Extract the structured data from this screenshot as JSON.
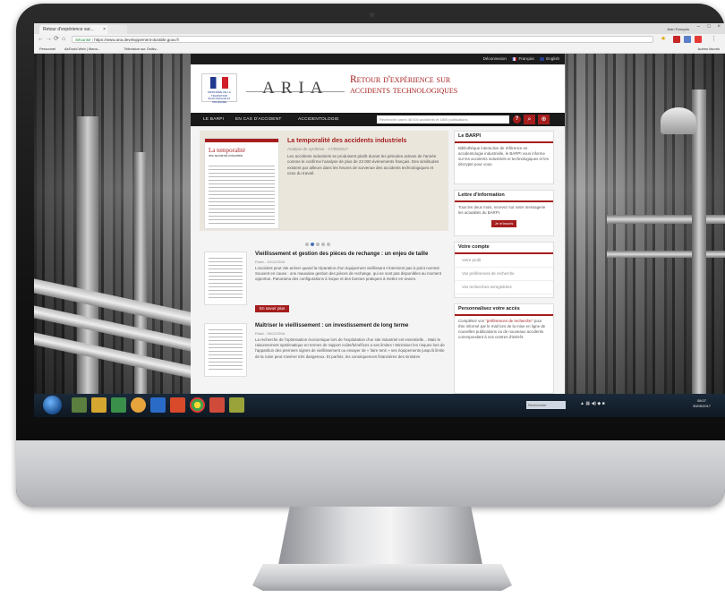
{
  "browser": {
    "tab_title": "Retour d'expérience sur...",
    "user_chip": "Jean François",
    "url_secure": "Sécurisé",
    "url": "https://www.aria.developpement-durable.gouv.fr",
    "bookmarks": [
      "Personnel",
      "AirDroid Web | Manu...",
      "Télévision sur Orditv..."
    ],
    "bookmarks_other": "Autres favoris"
  },
  "site": {
    "lang_bar": {
      "deconnexion": "Déconnexion",
      "francais": "Français",
      "english": "English"
    },
    "logo_text": "ARIA",
    "rf_text": "MINISTÈRE DE LA TRANSITION ÉCOLOGIQUE ET SOLIDAIRE",
    "title_line1": "Retour d'expérience sur",
    "title_line2": "accidents technologiques",
    "nav": {
      "items": [
        "LE BARPI",
        "EN CAS D'ACCIDENT",
        "ACCIDENTOLOGIE"
      ],
      "search_placeholder": "Recherche parmi 48 000 accidents et 1800 publications",
      "help": "?",
      "search_icon": "magnifier-icon",
      "advanced_icon": "advanced-search-icon"
    },
    "carousel": {
      "thumb_title": "La temporalité",
      "thumb_sub": "des accidents industriels",
      "title": "La temporalité des accidents industriels",
      "date": "Analyse de synthèse - 17/05/2017",
      "text": "Les accidents industriels se produisent plutôt durant les périodes actives de l'année comme le confirme l'analyse de plus de 23 000 événements français. Des similitudes existent par ailleurs dans les heures de survenue des accidents technologiques et ceux du travail."
    },
    "articles": [
      {
        "title": "Vieillissement et gestion des pièces de rechange : un enjeu de taille",
        "date": "Flash - 10/12/2016",
        "text": "L'accident peut vite arriver quand la réparation d'un équipement vieillissant n'intervient pas à point nommé. Souvent en cause : une mauvaise gestion des pièces de rechange, qui ne sont pas disponibles au moment opportun. Panorama des configurations à risque et des bonnes pratiques à mettre en œuvre.",
        "more": "En savoir plus"
      },
      {
        "title": "Maîtriser le vieillissement : un investissement de long terme",
        "date": "Flash - 08/12/2016",
        "text": "La recherche de l'optimisation économique lors de l'exploitation d'un site industriel est essentielle... Mais le raisonnement systématique en termes de rapport coûts/bénéfices a ses limites ! Minimiser les risques lors de l'apparition des premiers signes de vieillissement ou essayer de « faire tenir » ses équipements jusqu'à limite de la ruine peut s'avérer très dangereux. Et parfois, les conséquences financières des sinistres"
      }
    ],
    "sidebar": {
      "barpi_title": "Le BARPI",
      "barpi_text": "Bibliothèque interactive de référence en accidentologie industrielle, le BARPI vous informe sur les accidents industriels et technologiques et les décrypte pour vous.",
      "newsletter_title": "Lettre d'information",
      "newsletter_text": "Tous les deux mois, recevez sur votre messagerie les actualités du BARPI.",
      "newsletter_btn": "Je m'inscris",
      "account_title": "Votre compte",
      "account_links": [
        "Votre profil",
        "Vos préférences de recherche",
        "Vos recherches enregistrées"
      ],
      "access_title": "Personnalisez votre accès",
      "access_text_1": "Complétez vos",
      "access_link": "\"préférences de recherche\"",
      "access_text_2": "pour être informé par le mail lors de la mise en ligne de nouvelles publications ou de nouveaux accidents correspondant à vos centres d'intérêt."
    }
  },
  "taskbar": {
    "search": "Rechercher",
    "clock_time": "08:07",
    "clock_date": "30/05/2017"
  },
  "colors": {
    "brand_red": "#a51d1d",
    "nav_dark": "#1a1a1a",
    "active_dot": "#4a73b6"
  }
}
